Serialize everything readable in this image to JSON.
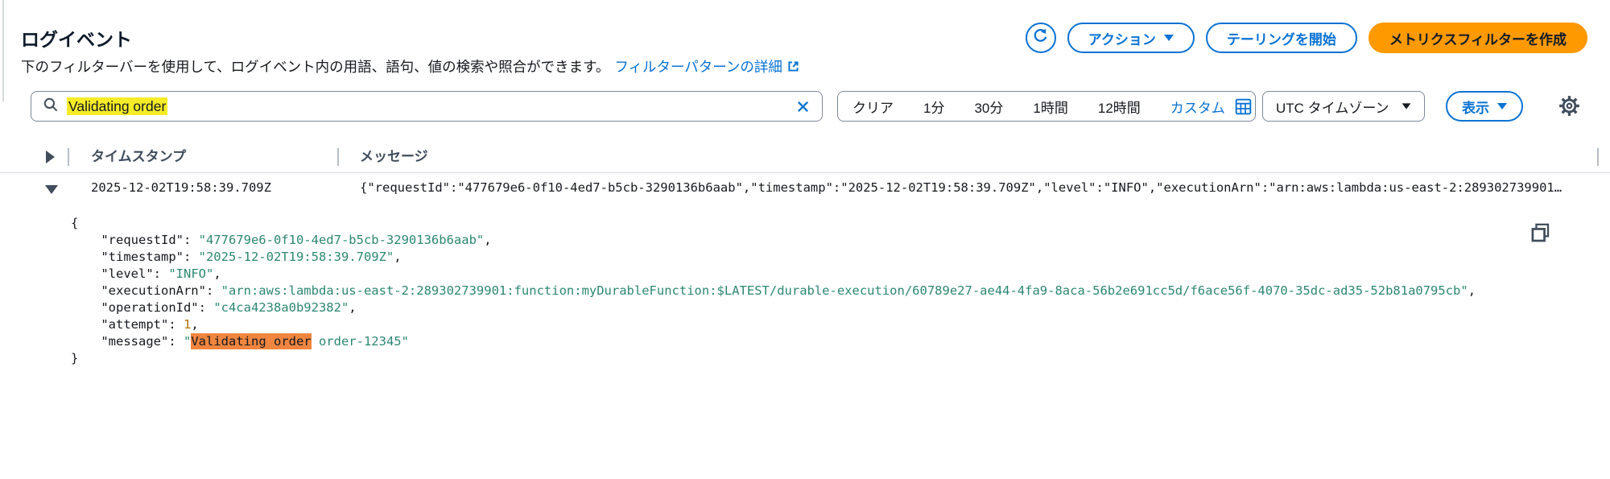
{
  "header": {
    "title": "ログイベント",
    "description": "下のフィルターバーを使用して、ログイベント内の用語、語句、値の検索や照合ができます。",
    "doc_link": "フィルターパターンの詳細",
    "actions_button": "アクション",
    "tailing_button": "テーリングを開始",
    "create_metric_button": "メトリクスフィルターを作成"
  },
  "filter_bar": {
    "query": "Validating order",
    "clear_button": "クリア",
    "ranges": [
      "1分",
      "30分",
      "1時間",
      "12時間"
    ],
    "custom_button": "カスタム",
    "timezone_select": "UTC タイムゾーン",
    "display_button": "表示"
  },
  "table": {
    "col_timestamp": "タイムスタンプ",
    "col_message": "メッセージ",
    "row_timestamp": "2025-12-02T19:58:39.709Z",
    "row_preview": "{\"requestId\":\"477679e6-0f10-4ed7-b5cb-3290136b6aab\",\"timestamp\":\"2025-12-02T19:58:39.709Z\",\"level\":\"INFO\",\"executionArn\":\"arn:aws:lambda:us-east-2:289302739901…"
  },
  "log_json": {
    "lines": [
      [
        {
          "t": "{",
          "c": "p"
        }
      ],
      [
        {
          "t": "    \"requestId\": ",
          "c": "k"
        },
        {
          "t": "\"477679e6-0f10-4ed7-b5cb-3290136b6aab\"",
          "c": "v"
        },
        {
          "t": ",",
          "c": "p"
        }
      ],
      [
        {
          "t": "    \"timestamp\": ",
          "c": "k"
        },
        {
          "t": "\"2025-12-02T19:58:39.709Z\"",
          "c": "v"
        },
        {
          "t": ",",
          "c": "p"
        }
      ],
      [
        {
          "t": "    \"level\": ",
          "c": "k"
        },
        {
          "t": "\"INFO\"",
          "c": "v"
        },
        {
          "t": ",",
          "c": "p"
        }
      ],
      [
        {
          "t": "    \"executionArn\": ",
          "c": "k"
        },
        {
          "t": "\"arn:aws:lambda:us-east-2:289302739901:function:myDurableFunction:$LATEST/durable-execution/60789e27-ae44-4fa9-8aca-56b2e691cc5d/f6ace56f-4070-35dc-ad35-52b81a0795cb\"",
          "c": "v"
        },
        {
          "t": ",",
          "c": "p"
        }
      ],
      [
        {
          "t": "    \"operationId\": ",
          "c": "k"
        },
        {
          "t": "\"c4ca4238a0b92382\"",
          "c": "v"
        },
        {
          "t": ",",
          "c": "p"
        }
      ],
      [
        {
          "t": "    \"attempt\": ",
          "c": "k"
        },
        {
          "t": "1",
          "c": "n"
        },
        {
          "t": ",",
          "c": "p"
        }
      ],
      [
        {
          "t": "    \"message\": ",
          "c": "k"
        },
        {
          "t": "\"",
          "c": "v"
        },
        {
          "t": "Validating order",
          "c": "hl"
        },
        {
          "t": " order-12345\"",
          "c": "v"
        }
      ],
      [
        {
          "t": "}",
          "c": "p"
        }
      ]
    ]
  },
  "colors": {
    "accent_blue": "#0972d3",
    "primary_orange": "#ff9900",
    "search_highlight_yellow": "#f5ec27",
    "match_highlight_orange": "#f0853f",
    "json_string_green": "#2d8773",
    "json_number_amber": "#b77008",
    "header_text": "#414d5c"
  }
}
